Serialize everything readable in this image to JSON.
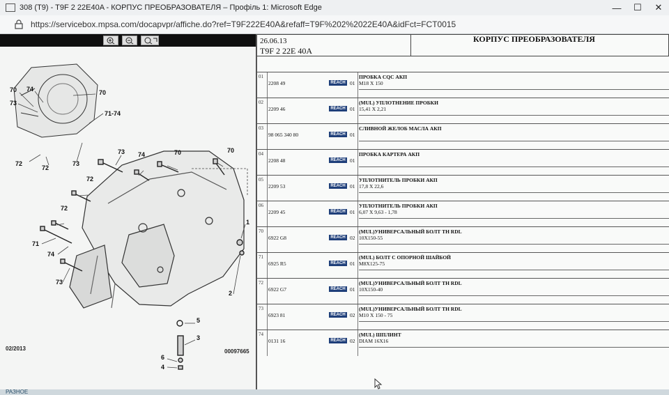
{
  "window": {
    "title": "308 (T9) - T9F 2 22E40A - КОРПУС ПРЕОБРАЗОВАТЕЛЯ – Профіль 1: Microsoft Edge",
    "minimize": "—",
    "maximize": "☐",
    "close": "✕"
  },
  "address": {
    "url": "https://servicebox.mpsa.com/docapvpr/affiche.do?ref=T9F222E40A&refaff=T9F%202%2022E40A&idFct=FCT0015"
  },
  "diagram": {
    "date": "02/2013",
    "ref_number": "00097665",
    "callouts": [
      "70",
      "74",
      "70",
      "73",
      "71-74",
      "73",
      "74",
      "70",
      "70",
      "72",
      "72",
      "73",
      "72",
      "72",
      "71",
      "74",
      "73",
      "1",
      "2",
      "5",
      "3",
      "6",
      "4"
    ]
  },
  "document": {
    "date": "26.06.13",
    "code": "T9F 2 22E 40A",
    "title": "КОРПУС ПРЕОБРАЗОВАТЕЛЯ",
    "reach_label": "REACH",
    "parts": [
      {
        "item": "01",
        "ref": "2208 49",
        "qty": "01",
        "name": "ПРОБКА CQC АКП",
        "spec": "M18 X 150"
      },
      {
        "item": "02",
        "ref": "2209 46",
        "qty": "01",
        "name": "(MUL) УПЛОТНЕНИЕ ПРОБКИ",
        "spec": "15,41 X 2,21"
      },
      {
        "item": "03",
        "ref": "98 065 340 80",
        "qty": "01",
        "name": "СЛИВНОЙ ЖЕЛОБ МАСЛА АКП",
        "spec": ""
      },
      {
        "item": "04",
        "ref": "2208 48",
        "qty": "01",
        "name": "ПРОБКА КАРТЕРА АКП",
        "spec": ""
      },
      {
        "item": "05",
        "ref": "2209 53",
        "qty": "01",
        "name": "УПЛОТНИТЕЛЬ ПРОБКИ АКП",
        "spec": "17,8 X 22,6"
      },
      {
        "item": "06",
        "ref": "2209 45",
        "qty": "01",
        "name": "УПЛОТНИТЕЛЬ ПРОБКИ АКП",
        "spec": "6,07 X 9,63 - 1,78"
      },
      {
        "item": "70",
        "ref": "6922 G8",
        "qty": "02",
        "name": "(MUL)УНИВЕРСАЛЬНЫЙ БОЛТ TH RDL",
        "spec": "10X150-55"
      },
      {
        "item": "71",
        "ref": "6925 R5",
        "qty": "01",
        "name": "(MUL) БОЛТ С ОПОРНОЙ ШАЙБОЙ",
        "spec": "M8X125-75"
      },
      {
        "item": "72",
        "ref": "6922 G7",
        "qty": "01",
        "name": "(MUL)УНИВЕРСАЛЬНЫЙ БОЛТ TH RDL",
        "spec": "10X150-40"
      },
      {
        "item": "73",
        "ref": "6923 81",
        "qty": "02",
        "name": "(MUL)УНИВЕРСАЛЬНЫЙ БОЛТ TH RDL",
        "spec": "M10 X 150 - 75"
      },
      {
        "item": "74",
        "ref": "0131 16",
        "qty": "02",
        "name": "(MUL) ШПЛИНТ",
        "spec": "DIAM 16X16"
      }
    ]
  },
  "statusbar": {
    "text": "РАЗНОЕ"
  },
  "colors": {
    "reach_badge": "#1f3f7a",
    "toolstrip": "#101010",
    "divider": "#555555"
  }
}
